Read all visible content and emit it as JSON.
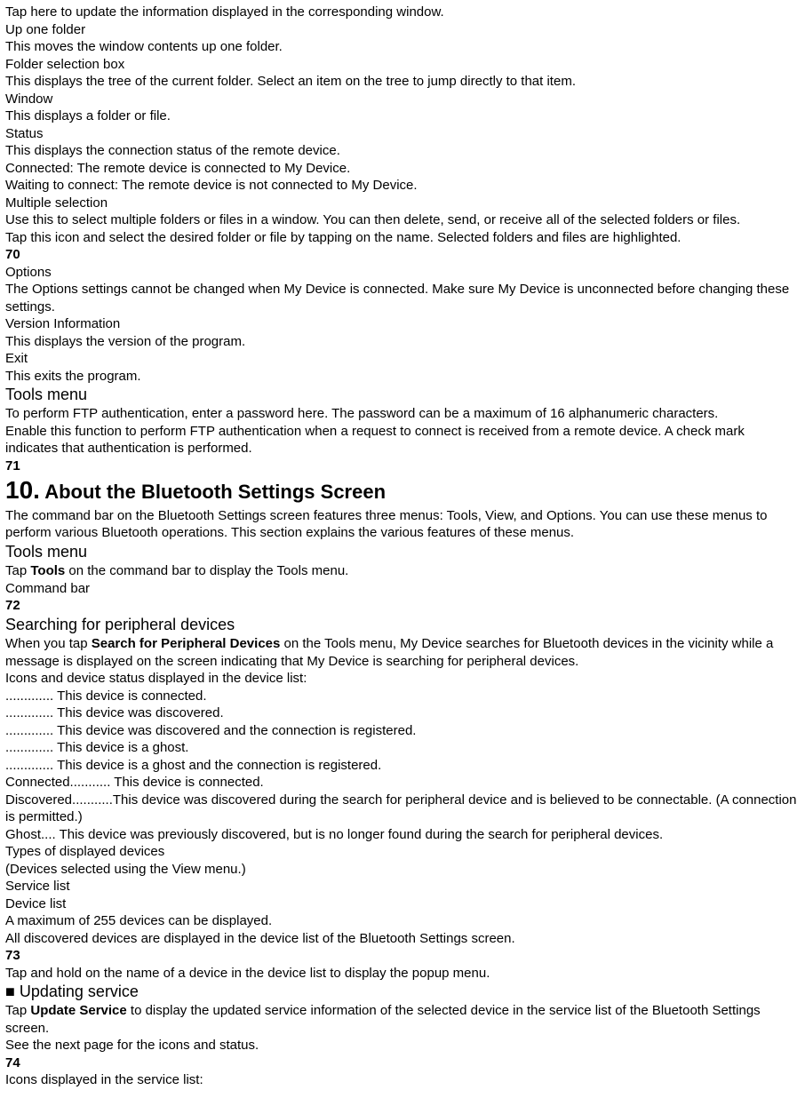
{
  "lines": [
    {
      "t": "Tap here to update the information displayed in the corresponding window.",
      "c": ""
    },
    {
      "t": "Up one folder",
      "c": ""
    },
    {
      "t": "This moves the window contents up one folder.",
      "c": ""
    },
    {
      "t": "Folder selection box",
      "c": ""
    },
    {
      "t": "This displays the tree of the current folder. Select an item on the tree to jump directly to that item.",
      "c": ""
    },
    {
      "t": "Window",
      "c": ""
    },
    {
      "t": "This displays a folder or file.",
      "c": ""
    },
    {
      "t": "Status",
      "c": ""
    },
    {
      "t": "This displays the connection status of the remote device.",
      "c": ""
    },
    {
      "t": "Connected: The remote device is connected to My Device.",
      "c": ""
    },
    {
      "t": "Waiting to connect: The remote device is not connected to My Device.",
      "c": ""
    },
    {
      "t": "Multiple selection",
      "c": ""
    },
    {
      "t": "Use this to select multiple folders or files in a window. You can then delete, send, or receive all of the selected folders or files.",
      "c": ""
    },
    {
      "t": "Tap this icon and select the desired folder or file by tapping on the name. Selected folders and files are highlighted.",
      "c": ""
    },
    {
      "t": "70",
      "c": "bold"
    },
    {
      "t": "Options",
      "c": ""
    },
    {
      "t": "The Options settings cannot be changed when My Device is connected. Make sure My Device is unconnected before changing these settings.",
      "c": ""
    },
    {
      "t": "Version Information",
      "c": ""
    },
    {
      "t": "This displays the version of the program.",
      "c": ""
    },
    {
      "t": "Exit",
      "c": ""
    },
    {
      "t": "This exits the program.",
      "c": ""
    },
    {
      "t": "Tools menu",
      "c": "h-medium"
    },
    {
      "t": "To perform FTP authentication, enter a password here. The password can be a maximum of 16 alphanumeric characters.",
      "c": ""
    },
    {
      "t": "Enable this function to perform FTP authentication when a request to connect is received from a remote device. A check mark indicates that authentication is performed.",
      "c": ""
    },
    {
      "t": "71",
      "c": "bold"
    }
  ],
  "chapter": {
    "num": "10.",
    "title": " About the Bluetooth Settings Screen"
  },
  "lines2": [
    {
      "t": "The command bar on the Bluetooth Settings screen features three menus: Tools, View, and Options. You can use these menus to perform various Bluetooth operations. This section explains the various features of these menus.",
      "c": ""
    },
    {
      "t": "Tools menu",
      "c": "h-medium"
    }
  ],
  "tap_tools": {
    "pre": "Tap ",
    "bold": "Tools",
    "post": " on the command bar to display the Tools menu."
  },
  "lines3": [
    {
      "t": "Command bar",
      "c": ""
    },
    {
      "t": "72",
      "c": "bold"
    },
    {
      "t": "Searching for peripheral devices",
      "c": "h-medium"
    }
  ],
  "search_para": {
    "pre": "When you tap ",
    "bold": "Search for Peripheral Devices",
    "post": " on the Tools menu, My Device searches for Bluetooth devices in the vicinity while a message is displayed on the screen indicating that My Device is searching for peripheral devices."
  },
  "lines4": [
    {
      "t": "Icons and device status displayed in the device list:",
      "c": ""
    },
    {
      "t": "............. This device is connected.",
      "c": ""
    },
    {
      "t": "............. This device was discovered.",
      "c": ""
    },
    {
      "t": "............. This device was discovered and the connection is registered.",
      "c": ""
    },
    {
      "t": "............. This device is a ghost.",
      "c": ""
    },
    {
      "t": "............. This device is a ghost and the connection is registered.",
      "c": ""
    },
    {
      "t": "Connected........... This device is connected.",
      "c": ""
    },
    {
      "t": "Discovered...........This device was discovered during the search for peripheral device and is believed to be connectable. (A connection is permitted.)",
      "c": ""
    },
    {
      "t": "Ghost.... This device was previously discovered, but is no longer found during the search for peripheral devices.",
      "c": ""
    },
    {
      "t": "Types of displayed devices",
      "c": ""
    },
    {
      "t": "(Devices selected using the View menu.)",
      "c": ""
    },
    {
      "t": "Service list",
      "c": ""
    },
    {
      "t": "Device list",
      "c": ""
    },
    {
      "t": "A maximum of 255 devices can be displayed.",
      "c": ""
    },
    {
      "t": "All discovered devices are displayed in the device list of the Bluetooth Settings screen.",
      "c": ""
    },
    {
      "t": "73",
      "c": "bold"
    },
    {
      "t": "Tap and hold on the name of a device in the device list to display the popup menu.",
      "c": ""
    },
    {
      "t": "■ Updating service",
      "c": "h-medium"
    }
  ],
  "update_para": {
    "pre": "Tap ",
    "bold": "Update Service",
    "post": " to display the updated service information of the selected device in the service list of the Bluetooth Settings screen."
  },
  "lines5": [
    {
      "t": "See the next page for the icons and status.",
      "c": ""
    },
    {
      "t": "74",
      "c": "bold"
    },
    {
      "t": "Icons displayed in the service list:",
      "c": ""
    }
  ]
}
